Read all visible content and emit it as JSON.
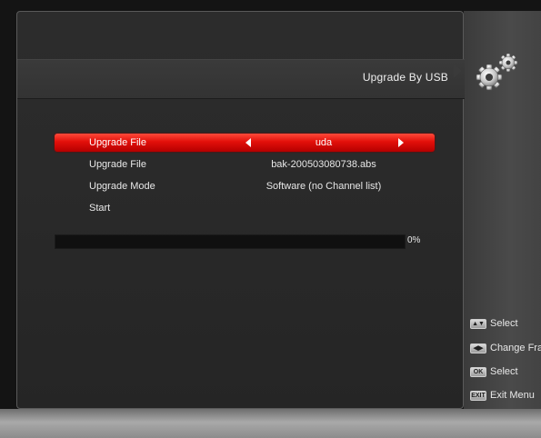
{
  "header": {
    "title": "Upgrade By USB"
  },
  "menu": {
    "rows": [
      {
        "label": "Upgrade File",
        "value": "uda",
        "selected": true
      },
      {
        "label": "Upgrade File",
        "value": "bak-200503080738.abs",
        "selected": false
      },
      {
        "label": "Upgrade Mode",
        "value": "Software (no Channel list)",
        "selected": false
      },
      {
        "label": "Start",
        "value": "",
        "selected": false
      }
    ]
  },
  "progress": {
    "value": 0,
    "label": "0%"
  },
  "help": {
    "items": [
      {
        "key": "▲▼",
        "icon": "up-down-key-icon",
        "label": "Select"
      },
      {
        "key": "◀▶",
        "icon": "left-right-key-icon",
        "label": "Change Fra"
      },
      {
        "key": "OK",
        "icon": "ok-key-icon",
        "label": "Select"
      },
      {
        "key": "EXIT",
        "icon": "exit-key-icon",
        "label": "Exit Menu"
      }
    ]
  },
  "colors": {
    "highlight": "#e20f0a",
    "panel": "#2a2a2a",
    "text": "#e8e8e8"
  },
  "icons": {
    "header": "gear-icon"
  }
}
